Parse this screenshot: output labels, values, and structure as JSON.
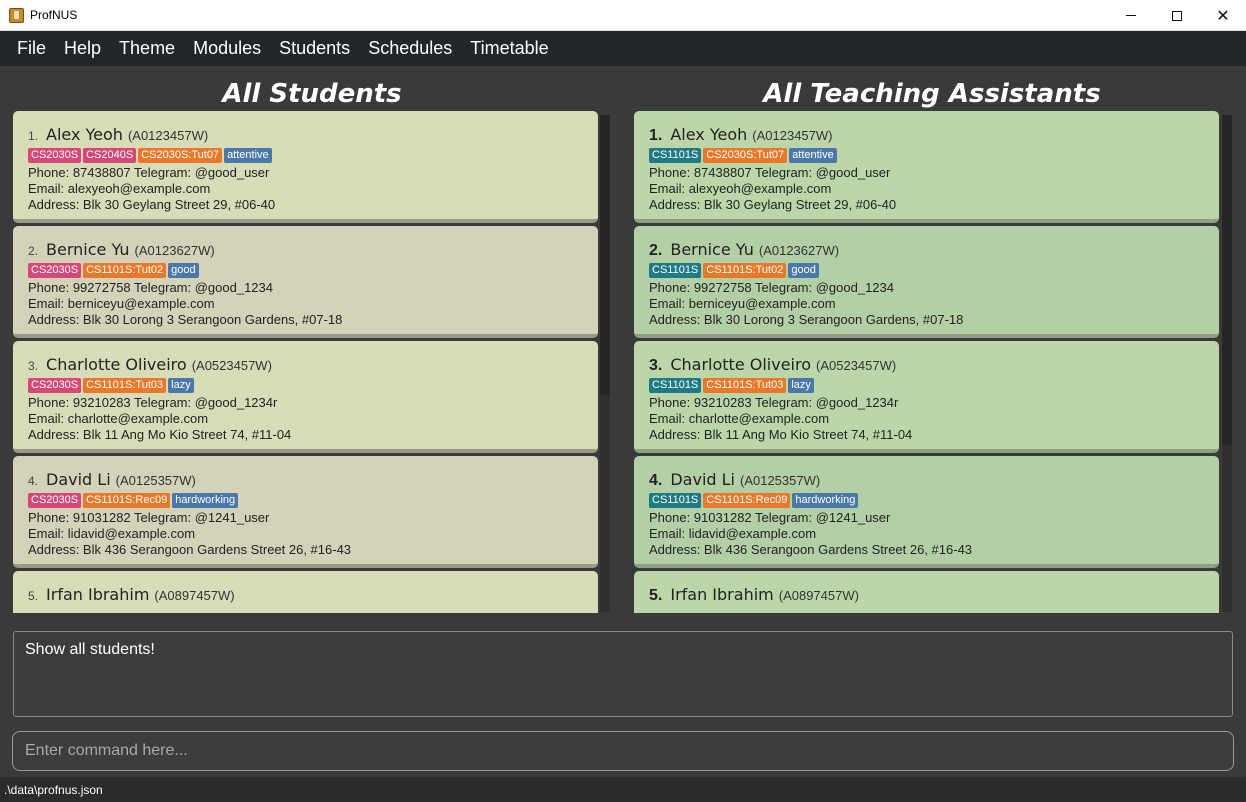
{
  "window": {
    "title": "ProfNUS"
  },
  "menu": [
    "File",
    "Help",
    "Theme",
    "Modules",
    "Students",
    "Schedules",
    "Timetable"
  ],
  "students_panel": {
    "title": "All Students",
    "cards": [
      {
        "index": "1.",
        "name": "Alex Yeoh",
        "id": "(A0123457W)",
        "tags": [
          {
            "text": "CS2030S",
            "color": "pink"
          },
          {
            "text": "CS2040S",
            "color": "pink"
          },
          {
            "text": "CS2030S:Tut07",
            "color": "orange"
          },
          {
            "text": "attentive",
            "color": "blue"
          }
        ],
        "phone": "Phone: 87438807 Telegram: @good_user",
        "email": "Email: alexyeoh@example.com",
        "address": "Address: Blk 30 Geylang Street 29, #06-40"
      },
      {
        "index": "2.",
        "name": "Bernice Yu",
        "id": "(A0123627W)",
        "tags": [
          {
            "text": "CS2030S",
            "color": "pink"
          },
          {
            "text": "CS1101S:Tut02",
            "color": "orange"
          },
          {
            "text": "good",
            "color": "blue"
          }
        ],
        "phone": "Phone: 99272758 Telegram: @good_1234",
        "email": "Email: berniceyu@example.com",
        "address": "Address: Blk 30 Lorong 3 Serangoon Gardens, #07-18"
      },
      {
        "index": "3.",
        "name": "Charlotte Oliveiro",
        "id": "(A0523457W)",
        "tags": [
          {
            "text": "CS2030S",
            "color": "pink"
          },
          {
            "text": "CS1101S:Tut03",
            "color": "orange"
          },
          {
            "text": "lazy",
            "color": "blue"
          }
        ],
        "phone": "Phone: 93210283 Telegram: @good_1234r",
        "email": "Email: charlotte@example.com",
        "address": "Address: Blk 11 Ang Mo Kio Street 74, #11-04"
      },
      {
        "index": "4.",
        "name": "David Li",
        "id": "(A0125357W)",
        "tags": [
          {
            "text": "CS2030S",
            "color": "pink"
          },
          {
            "text": "CS1101S:Rec09",
            "color": "orange"
          },
          {
            "text": "hardworking",
            "color": "blue"
          }
        ],
        "phone": "Phone: 91031282 Telegram: @1241_user",
        "email": "Email: lidavid@example.com",
        "address": "Address: Blk 436 Serangoon Gardens Street 26, #16-43"
      },
      {
        "index": "5.",
        "name": "Irfan Ibrahim",
        "id": "(A0897457W)",
        "tags": [],
        "phone": "",
        "email": "",
        "address": ""
      }
    ]
  },
  "tas_panel": {
    "title": "All Teaching Assistants",
    "cards": [
      {
        "index": "1.",
        "name": "Alex Yeoh",
        "id": "(A0123457W)",
        "tags": [
          {
            "text": "CS1101S",
            "color": "teal"
          },
          {
            "text": "CS2030S:Tut07",
            "color": "orange"
          },
          {
            "text": "attentive",
            "color": "blue"
          }
        ],
        "phone": "Phone: 87438807 Telegram: @good_user",
        "email": "Email: alexyeoh@example.com",
        "address": "Address: Blk 30 Geylang Street 29, #06-40"
      },
      {
        "index": "2.",
        "name": "Bernice Yu",
        "id": "(A0123627W)",
        "tags": [
          {
            "text": "CS1101S",
            "color": "teal"
          },
          {
            "text": "CS1101S:Tut02",
            "color": "orange"
          },
          {
            "text": "good",
            "color": "blue"
          }
        ],
        "phone": "Phone: 99272758 Telegram: @good_1234",
        "email": "Email: berniceyu@example.com",
        "address": "Address: Blk 30 Lorong 3 Serangoon Gardens, #07-18"
      },
      {
        "index": "3.",
        "name": "Charlotte Oliveiro",
        "id": "(A0523457W)",
        "tags": [
          {
            "text": "CS1101S",
            "color": "teal"
          },
          {
            "text": "CS1101S:Tut03",
            "color": "orange"
          },
          {
            "text": "lazy",
            "color": "blue"
          }
        ],
        "phone": "Phone: 93210283 Telegram: @good_1234r",
        "email": "Email: charlotte@example.com",
        "address": "Address: Blk 11 Ang Mo Kio Street 74, #11-04"
      },
      {
        "index": "4.",
        "name": "David Li",
        "id": "(A0125357W)",
        "tags": [
          {
            "text": "CS1101S",
            "color": "teal"
          },
          {
            "text": "CS1101S:Rec09",
            "color": "orange"
          },
          {
            "text": "hardworking",
            "color": "blue"
          }
        ],
        "phone": "Phone: 91031282 Telegram: @1241_user",
        "email": "Email: lidavid@example.com",
        "address": "Address: Blk 436 Serangoon Gardens Street 26, #16-43"
      },
      {
        "index": "5.",
        "name": "Irfan Ibrahim",
        "id": "(A0897457W)",
        "tags": [],
        "phone": "",
        "email": "",
        "address": ""
      }
    ]
  },
  "result": {
    "text": "Show all students!"
  },
  "command": {
    "placeholder": "Enter command here..."
  },
  "status": {
    "path": ".\\data\\profnus.json"
  },
  "colors": {
    "pink": "#d6487a",
    "orange": "#e8782a",
    "blue": "#4a78a8",
    "teal": "#1f7a86"
  }
}
